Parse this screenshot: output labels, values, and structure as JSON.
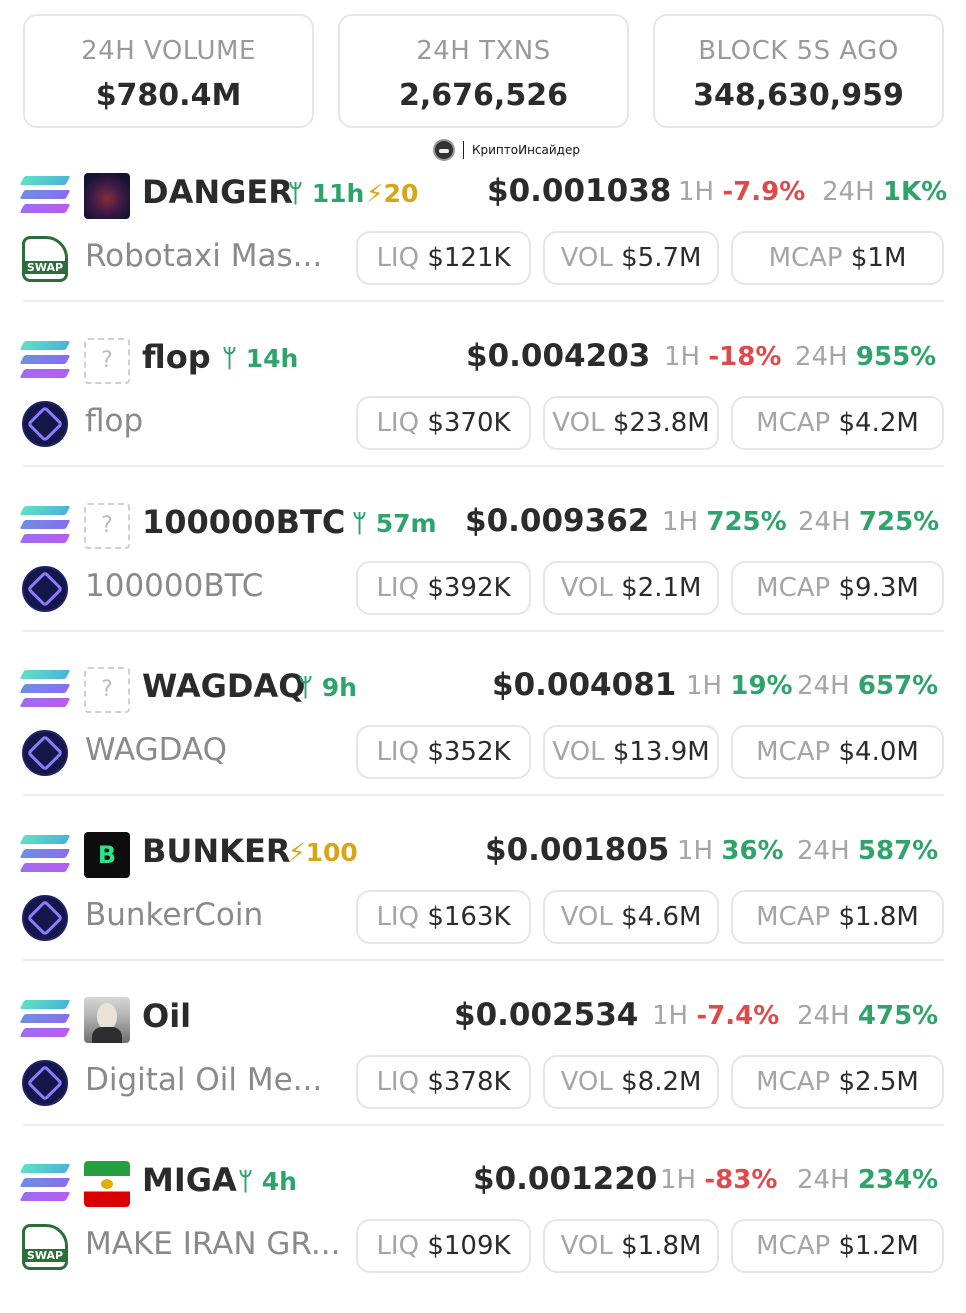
{
  "stats": {
    "volume_label": "24H VOLUME",
    "volume_value": "$780.4M",
    "txns_label": "24H TXNS",
    "txns_value": "2,676,526",
    "block_label": "BLOCK 5S AGO",
    "block_value": "348,630,959"
  },
  "watermark": {
    "text": "КриптоИнсайдер"
  },
  "labels": {
    "h1": "1H",
    "h24": "24H",
    "liq": "LIQ",
    "vol": "VOL",
    "mcap": "MCAP"
  },
  "tokens": [
    {
      "symbol": "DANGER",
      "age": "11h",
      "boost": "20",
      "price": "$0.001038",
      "change_1h": "-7.9%",
      "change_24h": "1K%",
      "name": "Robotaxi Mas...",
      "liq": "$121K",
      "vol": "$5.7M",
      "mcap": "$1M",
      "dex": "swap-icon",
      "image": "danger-token"
    },
    {
      "symbol": "flop",
      "age": "14h",
      "price": "$0.004203",
      "change_1h": "-18%",
      "change_24h": "955%",
      "name": "flop",
      "liq": "$370K",
      "vol": "$23.8M",
      "mcap": "$4.2M",
      "dex": "raydium-icon",
      "image": "unknown"
    },
    {
      "symbol": "100000BTC",
      "age": "57m",
      "price": "$0.009362",
      "change_1h": "725%",
      "change_24h": "725%",
      "name": "100000BTC",
      "liq": "$392K",
      "vol": "$2.1M",
      "mcap": "$9.3M",
      "dex": "raydium-icon",
      "image": "unknown"
    },
    {
      "symbol": "WAGDAQ",
      "age": "9h",
      "price": "$0.004081",
      "change_1h": "19%",
      "change_24h": "657%",
      "name": "WAGDAQ",
      "liq": "$352K",
      "vol": "$13.9M",
      "mcap": "$4.0M",
      "dex": "raydium-icon",
      "image": "unknown"
    },
    {
      "symbol": "BUNKER",
      "boost": "100",
      "price": "$0.001805",
      "change_1h": "36%",
      "change_24h": "587%",
      "name": "BunkerCoin",
      "liq": "$163K",
      "vol": "$4.6M",
      "mcap": "$1.8M",
      "dex": "raydium-icon",
      "image": "bunker-token"
    },
    {
      "symbol": "Oil",
      "price": "$0.002534",
      "change_1h": "-7.4%",
      "change_24h": "475%",
      "name": "Digital Oil Me...",
      "liq": "$378K",
      "vol": "$8.2M",
      "mcap": "$2.5M",
      "dex": "raydium-icon",
      "image": "portrait-token"
    },
    {
      "symbol": "MIGA",
      "age": "4h",
      "price": "$0.001220",
      "change_1h": "-83%",
      "change_24h": "234%",
      "name": "MAKE IRAN GR...",
      "liq": "$109K",
      "vol": "$1.8M",
      "mcap": "$1.2M",
      "dex": "swap-icon",
      "image": "iran-flag-token"
    }
  ],
  "colors": {
    "positive": "#2ea36a",
    "negative": "#e04949",
    "boost": "#d9a41a",
    "muted": "#a5a5a5"
  },
  "icons": {
    "new_pair": "sprout-icon",
    "boost": "lightning-icon",
    "chain": "solana-icon"
  }
}
